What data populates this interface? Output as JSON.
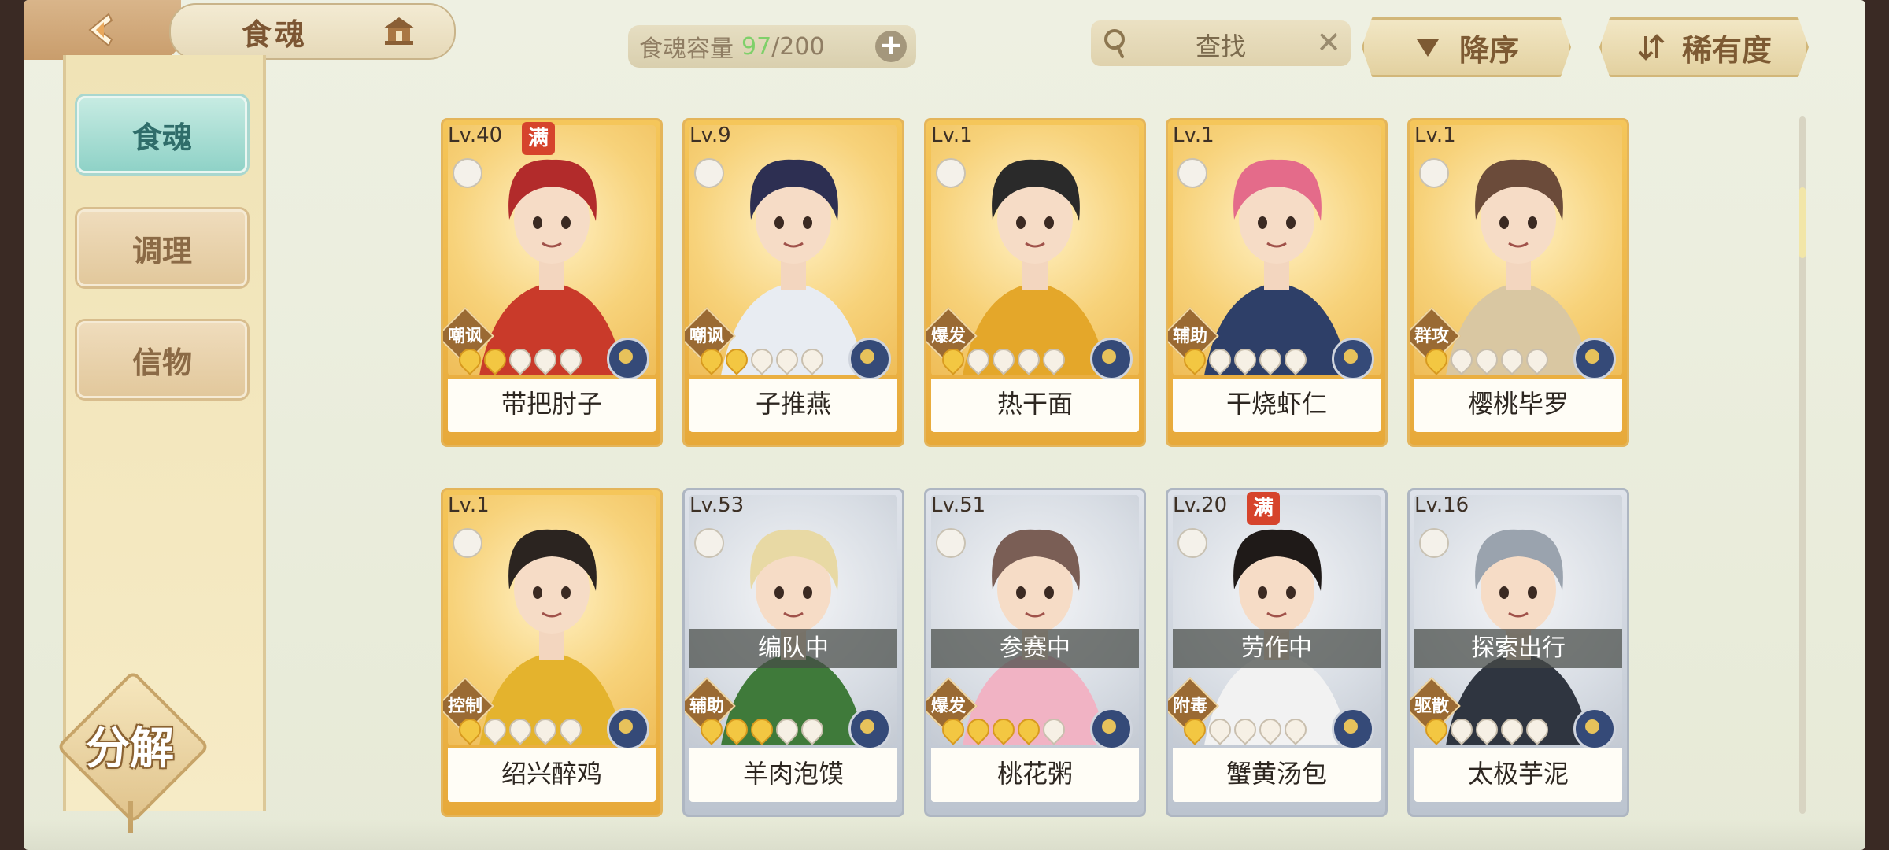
{
  "header": {
    "title": "食魂",
    "capacity_label": "食魂容量",
    "capacity_current": "97",
    "capacity_max": "/200",
    "search_placeholder": "查找",
    "sort_label": "降序",
    "rarity_label": "稀有度"
  },
  "sidebar": {
    "items": [
      {
        "label": "食魂",
        "active": true
      },
      {
        "label": "调理",
        "active": false
      },
      {
        "label": "信物",
        "active": false
      }
    ],
    "decompose_label": "分解"
  },
  "cards": [
    {
      "level": "Lv.40",
      "full_badge": "满",
      "role": "嘲讽",
      "name": "带把肘子",
      "stars_on": 2,
      "stars_total": 5,
      "frame": "gold",
      "status": ""
    },
    {
      "level": "Lv.9",
      "full_badge": "",
      "role": "嘲讽",
      "name": "子推燕",
      "stars_on": 2,
      "stars_total": 5,
      "frame": "gold",
      "status": ""
    },
    {
      "level": "Lv.1",
      "full_badge": "",
      "role": "爆发",
      "name": "热干面",
      "stars_on": 1,
      "stars_total": 5,
      "frame": "gold",
      "status": ""
    },
    {
      "level": "Lv.1",
      "full_badge": "",
      "role": "辅助",
      "name": "干烧虾仁",
      "stars_on": 1,
      "stars_total": 5,
      "frame": "gold",
      "status": ""
    },
    {
      "level": "Lv.1",
      "full_badge": "",
      "role": "群攻",
      "name": "樱桃毕罗",
      "stars_on": 1,
      "stars_total": 5,
      "frame": "gold",
      "status": ""
    },
    {
      "level": "Lv.1",
      "full_badge": "",
      "role": "控制",
      "name": "绍兴醉鸡",
      "stars_on": 1,
      "stars_total": 5,
      "frame": "gold",
      "status": ""
    },
    {
      "level": "Lv.53",
      "full_badge": "",
      "role": "辅助",
      "name": "羊肉泡馍",
      "stars_on": 3,
      "stars_total": 5,
      "frame": "silver",
      "status": "编队中"
    },
    {
      "level": "Lv.51",
      "full_badge": "",
      "role": "爆发",
      "name": "桃花粥",
      "stars_on": 4,
      "stars_total": 5,
      "frame": "silver",
      "status": "参赛中"
    },
    {
      "level": "Lv.20",
      "full_badge": "满",
      "role": "附毒",
      "name": "蟹黄汤包",
      "stars_on": 1,
      "stars_total": 5,
      "frame": "silver",
      "status": "劳作中"
    },
    {
      "level": "Lv.16",
      "full_badge": "",
      "role": "驱散",
      "name": "太极芋泥",
      "stars_on": 1,
      "stars_total": 5,
      "frame": "silver",
      "status": "探索出行"
    }
  ]
}
